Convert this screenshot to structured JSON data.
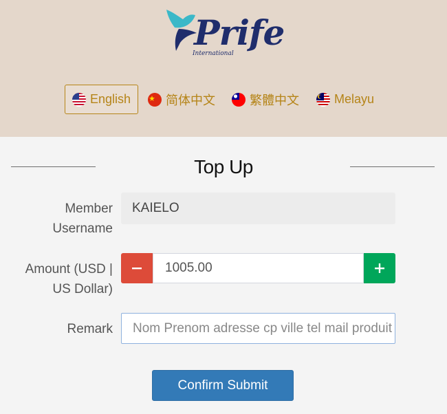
{
  "brand": {
    "name": "Prife",
    "sub": "International",
    "colors": {
      "navy": "#1f2d6c",
      "teal": "#3bb8c8"
    }
  },
  "languages": [
    {
      "label": "English",
      "icon": "us-flag-icon",
      "active": true
    },
    {
      "label": "简体中文",
      "icon": "china-flag-icon",
      "active": false
    },
    {
      "label": "繁體中文",
      "icon": "taiwan-flag-icon",
      "active": false
    },
    {
      "label": "Melayu",
      "icon": "malaysia-flag-icon",
      "active": false
    }
  ],
  "page": {
    "title": "Top Up"
  },
  "form": {
    "member": {
      "label_line1": "Member",
      "label_line2": "Username",
      "value": "KAIELO"
    },
    "amount": {
      "label_line1": "Amount (USD |",
      "label_line2": "US Dollar)",
      "value": "1005.00",
      "minus": "−",
      "plus": "+"
    },
    "remark": {
      "label": "Remark",
      "placeholder": "Nom Prenom adresse cp ville tel mail produit"
    },
    "submit_label": "Confirm Submit"
  },
  "colors": {
    "header_bg": "#e4d7cb",
    "lang_text": "#b58417",
    "minus_bg": "#dd4b39",
    "plus_bg": "#00a65a",
    "submit_bg": "#337ab7"
  }
}
